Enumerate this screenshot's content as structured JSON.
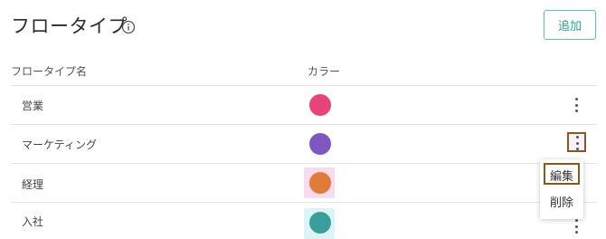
{
  "page": {
    "title": "フロータイプ",
    "add_label": "追加"
  },
  "table": {
    "headers": {
      "name": "フロータイプ名",
      "color": "カラー"
    },
    "rows": [
      {
        "name": "営業",
        "color": "#e8437a"
      },
      {
        "name": "マーケティング",
        "color": "#7e57c2"
      },
      {
        "name": "経理",
        "color": "#e07b3a",
        "highlight": "#f6dcee"
      },
      {
        "name": "入社",
        "color": "#3a9e9c",
        "highlight": "#dcf4f6"
      }
    ]
  },
  "menu": {
    "edit": "編集",
    "delete": "削除"
  },
  "colors": {
    "accent": "#2aa894",
    "annotation": "#8a5a14"
  },
  "icons": [
    "info-icon",
    "more-vert-icon"
  ]
}
